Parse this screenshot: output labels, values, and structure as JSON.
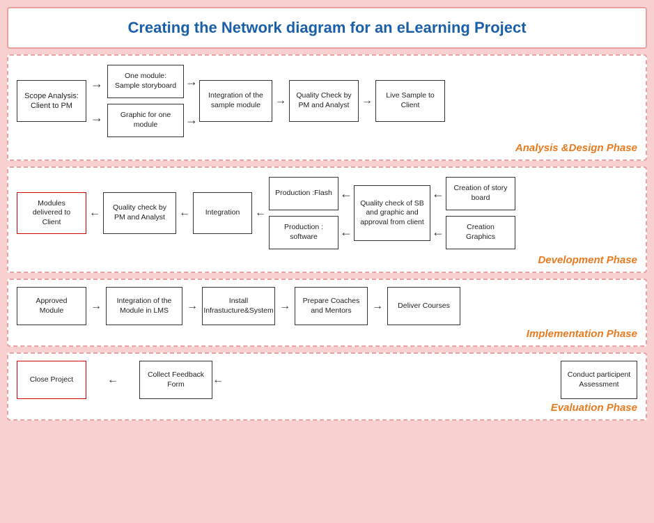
{
  "title": "Creating the Network diagram for an eLearning Project",
  "phase1": {
    "label": "Analysis &Design Phase",
    "nodes": {
      "scope": "Scope Analysis: Client to PM",
      "storyboard": "One module: Sample storyboard",
      "graphic": "Graphic for one module",
      "integration": "Integration of the sample module",
      "quality": "Quality Check by PM and Analyst",
      "live": "Live Sample to Client"
    }
  },
  "phase2": {
    "label": "Development Phase",
    "nodes": {
      "modules": "Modules delivered to Client",
      "quality": "Quality check by PM and Analyst",
      "integration": "Integration",
      "flash": "Production :Flash",
      "software": "Production : software",
      "qualitySB": "Quality check of SB and graphic and approval from client",
      "storyboard": "Creation of story board",
      "graphics": "Creation Graphics"
    }
  },
  "phase3": {
    "label": "Implementation Phase",
    "nodes": {
      "approved": "Approved Module",
      "lms": "Integration of the Module in LMS",
      "install": "Install Infrastucture&System",
      "coaches": "Prepare Coaches and Mentors",
      "deliver": "Deliver Courses"
    }
  },
  "phase4": {
    "label": "Evaluation Phase",
    "nodes": {
      "close": "Close Project",
      "collect": "Collect Feedback Form",
      "conduct": "Conduct participent Assessment"
    }
  }
}
